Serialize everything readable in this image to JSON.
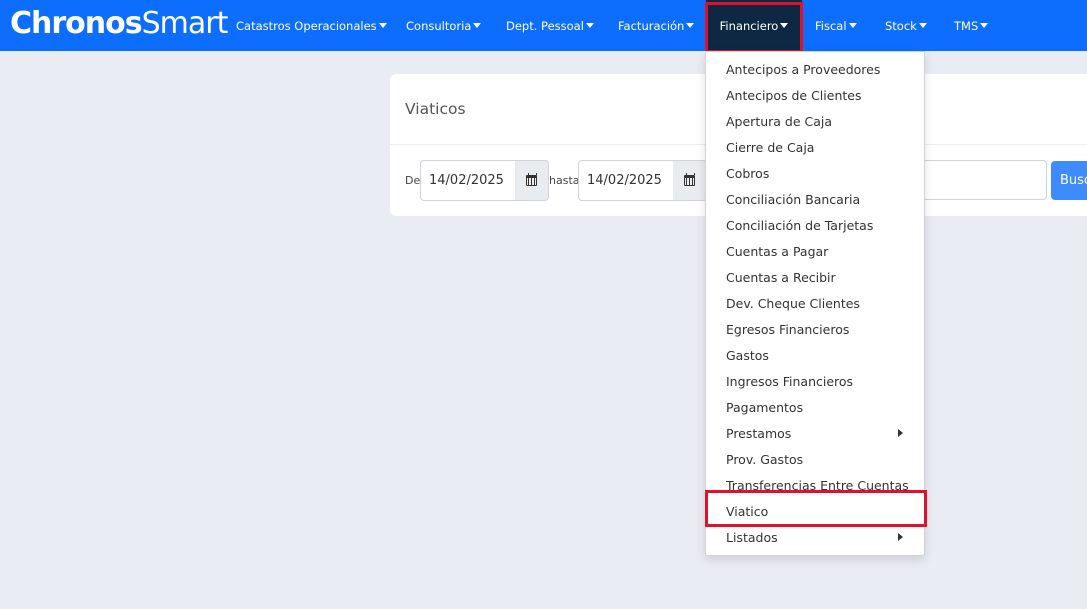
{
  "brand": {
    "logo_bold": "Chronos",
    "logo_light": "Smart"
  },
  "nav": {
    "items": [
      {
        "label": "Catastros Operacionales"
      },
      {
        "label": "Consultoria"
      },
      {
        "label": "Dept. Pessoal"
      },
      {
        "label": "Facturación"
      },
      {
        "label": "Financiero",
        "active": true
      },
      {
        "label": "Fiscal"
      },
      {
        "label": "Stock"
      },
      {
        "label": "TMS"
      }
    ]
  },
  "page": {
    "title": "Viaticos",
    "from_label": "De",
    "from_date": "14/02/2025",
    "to_label": "hasta",
    "to_date": "14/02/2025",
    "search_label": "Busc"
  },
  "dropdown": {
    "items": [
      {
        "label": "Antecipos a Proveedores"
      },
      {
        "label": "Antecipos de Clientes"
      },
      {
        "label": "Apertura de Caja"
      },
      {
        "label": "Cierre de Caja"
      },
      {
        "label": "Cobros"
      },
      {
        "label": "Conciliación Bancaria"
      },
      {
        "label": "Conciliación de Tarjetas"
      },
      {
        "label": "Cuentas a Pagar"
      },
      {
        "label": "Cuentas a Recibir"
      },
      {
        "label": "Dev. Cheque Clientes"
      },
      {
        "label": "Egresos Financieros"
      },
      {
        "label": "Gastos"
      },
      {
        "label": "Ingresos Financieros"
      },
      {
        "label": "Pagamentos"
      },
      {
        "label": "Prestamos",
        "submenu": true
      },
      {
        "label": "Prov. Gastos"
      },
      {
        "label": "Transferencias Entre Cuentas"
      },
      {
        "label": "Viatico",
        "highlighted": true
      },
      {
        "label": "Listados",
        "submenu": true
      }
    ]
  },
  "colors": {
    "navbar": "#0d6efd",
    "nav_active": "#0e2742",
    "highlight": "#e0112d",
    "background": "#e9ecf2"
  }
}
